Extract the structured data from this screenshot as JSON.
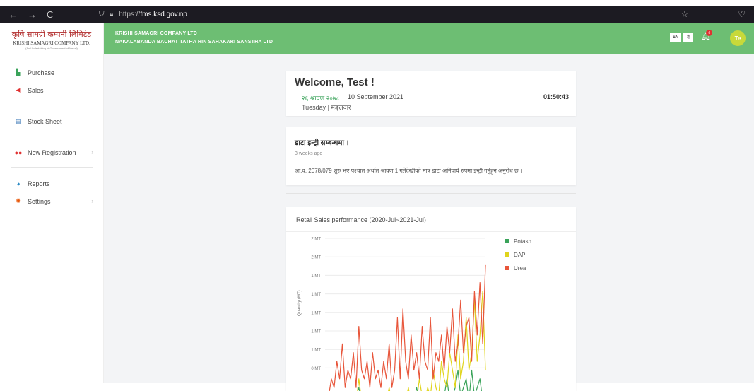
{
  "browser": {
    "back": "←",
    "forward": "→",
    "reload": "C",
    "url_prefix": "https://",
    "url_host": "fms.ksd.gov.np",
    "star": "☆",
    "pocket": "♡"
  },
  "logo": {
    "name_np": "कृषि सामग्री कम्पनी लिमिटेड",
    "name_en": "KRISHI SAMAGRI COMPANY LTD.",
    "tagline": "(An Undertaking of Government of Nepal)"
  },
  "sidebar": {
    "items": [
      {
        "label": "Purchase",
        "icon": "bar-chart-icon",
        "color": "#3aa35a"
      },
      {
        "label": "Sales",
        "icon": "tag-icon",
        "color": "#e03131"
      },
      {
        "label": "Stock Sheet",
        "icon": "clipboard-icon",
        "color": "#2b6cb0"
      },
      {
        "label": "New Registration",
        "icon": "users-icon",
        "color": "#e03131"
      },
      {
        "label": "Reports",
        "icon": "pie-chart-icon",
        "color": "#2b8ac4"
      },
      {
        "label": "Settings",
        "icon": "gear-icon",
        "color": "#e8590c"
      }
    ]
  },
  "header": {
    "line1": "KRISHI SAMAGRI COMPANY LTD",
    "line2": "NAKALABANDA BACHAT TATHA RIN SAHAKARI SANSTHA LTD",
    "lang_en": "EN",
    "lang_np": "ने",
    "notification_count": "4",
    "avatar_initials": "Te",
    "bg_color": "#6dbe73"
  },
  "welcome": {
    "title": "Welcome, Test !",
    "date_np": "२६ श्रावण २०७८",
    "date_en": "10 September 2021",
    "time": "01:50:43",
    "day": "Tuesday | मङ्गलवार"
  },
  "notice": {
    "title": "डाटा इन्ट्री सम्बन्धमा ।",
    "ago": "3 weeks ago",
    "message": "आ.व. 2078/079 शुरु भए पश्चात अर्थात श्रावण 1 गतेदेखीको मात्र डाटा अनिवार्य रुपमा इन्ट्री गर्नुहुन अनुरोध छ ।"
  },
  "chart_data": {
    "type": "line",
    "title": "Retail Sales performance (2020-Jul~2021-Jul)",
    "ylabel": "Quantity (MT)",
    "y_ticks": [
      "2 MT",
      "2 MT",
      "1 MT",
      "1 MT",
      "1 MT",
      "1 MT",
      "1 MT",
      "0 MT"
    ],
    "legend": [
      {
        "name": "Potash",
        "color": "#3aa35a"
      },
      {
        "name": "DAP",
        "color": "#e0d41c"
      },
      {
        "name": "Urea",
        "color": "#e8553a"
      }
    ],
    "series": [
      {
        "name": "Potash",
        "color": "#3aa35a",
        "values": [
          0.05,
          0.1,
          0.02,
          0.15,
          0.05,
          0.02,
          0.1,
          0.05,
          0.02,
          0.05,
          0.1,
          0.2,
          0.05,
          0.1,
          0.02,
          0.05,
          0.1,
          0.02,
          0.05,
          0.15,
          0.02,
          0.05,
          0.1,
          0.05,
          0.02,
          0.1,
          0.05,
          0.02,
          0.05,
          0.1,
          0.02,
          0.05,
          0.2,
          0.05,
          0.1,
          0.02,
          0.05,
          0.1,
          0.02,
          0.05,
          0.15,
          0.05,
          0.1,
          0.3,
          0.05,
          0.1,
          0.2,
          0.4,
          0.1,
          0.2,
          0.3,
          0.05,
          0.4,
          0.1,
          0.2,
          0.3,
          0.05,
          0.1
        ]
      },
      {
        "name": "DAP",
        "color": "#e0d41c",
        "values": [
          0.02,
          0.05,
          0.1,
          0.02,
          0.05,
          0.1,
          0.02,
          0.05,
          0.1,
          0.15,
          0.02,
          0.3,
          0.05,
          0.02,
          0.1,
          0.05,
          0.02,
          0.1,
          0.05,
          0.02,
          0.1,
          0.05,
          0.2,
          0.02,
          0.1,
          0.05,
          0.02,
          0.1,
          0.05,
          0.2,
          0.02,
          0.1,
          0.05,
          0.3,
          0.1,
          0.05,
          0.2,
          0.1,
          0.4,
          0.2,
          0.1,
          0.5,
          0.3,
          0.2,
          0.6,
          0.4,
          0.2,
          0.8,
          0.3,
          0.5,
          1.0,
          0.4,
          0.6,
          1.2,
          0.5,
          0.8,
          1.3,
          0.4
        ]
      },
      {
        "name": "Urea",
        "color": "#e8553a",
        "values": [
          0.1,
          0.3,
          0.2,
          0.5,
          0.3,
          0.7,
          0.2,
          0.4,
          0.3,
          0.6,
          0.2,
          0.9,
          0.4,
          0.3,
          0.5,
          0.2,
          0.6,
          0.3,
          0.4,
          0.2,
          0.5,
          0.3,
          0.7,
          0.2,
          0.4,
          1.0,
          0.3,
          1.1,
          0.5,
          0.3,
          0.8,
          0.4,
          0.6,
          0.3,
          0.9,
          0.5,
          0.4,
          1.0,
          0.3,
          0.6,
          0.5,
          0.8,
          0.4,
          0.9,
          0.6,
          1.1,
          0.5,
          0.7,
          1.2,
          0.6,
          0.9,
          1.0,
          0.5,
          1.3,
          0.8,
          1.4,
          0.7,
          1.6
        ]
      }
    ],
    "ylim": [
      0,
      1.8
    ]
  }
}
